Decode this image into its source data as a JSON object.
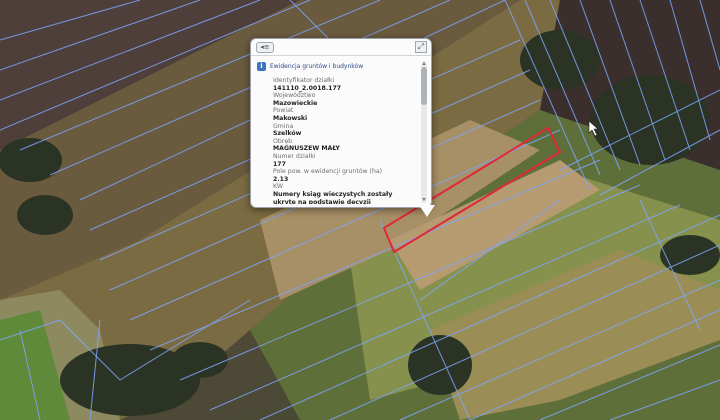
{
  "popup": {
    "back_icon": "back-arrow-icon",
    "close_icon": "close-icon",
    "header_icon": "info-icon",
    "header_title": "Ewidencja gruntów i budynków",
    "scroll_up_icon": "scroll-up-icon",
    "scroll_down_icon": "scroll-down-icon",
    "fields": [
      {
        "label": "Identyfikator działki",
        "value": "141110_2.0018.177"
      },
      {
        "label": "Województwo",
        "value": "Mazowieckie"
      },
      {
        "label": "Powiat",
        "value": "Makowski"
      },
      {
        "label": "Gmina",
        "value": "Szelków"
      },
      {
        "label": "Obręb",
        "value": "MAGNUSZEW MAŁY"
      },
      {
        "label": "Numer działki",
        "value": "177"
      },
      {
        "label": "Pole pow. w ewidencji gruntów (ha)",
        "value": "2.13"
      },
      {
        "label": "KW",
        "value": "Numery ksiąg wieczystych zostały ukryte na podstawie decyzji"
      }
    ]
  },
  "map": {
    "parcel_outline_color": "#e0283c",
    "boundary_line_color": "#7fa6ff",
    "cursor_icon": "mouse-pointer-icon"
  }
}
